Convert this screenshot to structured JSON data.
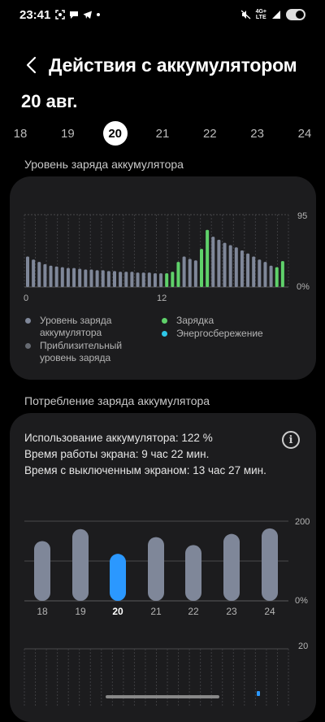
{
  "status": {
    "time": "23:41",
    "network_top": "4G+",
    "network_bottom": "LTE"
  },
  "header": {
    "title": "Действия с аккумулятором",
    "back_icon": "chevron-left-icon"
  },
  "date": "20 авг.",
  "days": [
    {
      "label": "18",
      "selected": false
    },
    {
      "label": "19",
      "selected": false
    },
    {
      "label": "20",
      "selected": true
    },
    {
      "label": "21",
      "selected": false
    },
    {
      "label": "22",
      "selected": false
    },
    {
      "label": "23",
      "selected": false
    },
    {
      "label": "24",
      "selected": false
    }
  ],
  "level_section": {
    "title": "Уровень заряда аккумулятора",
    "legend": {
      "level": "Уровень заряда аккумулятора",
      "charging": "Зарядка",
      "estimated": "Приблизительный уровень заряда",
      "power_saving": "Энергосбережение"
    }
  },
  "usage_section": {
    "title": "Потребление заряда аккумулятора",
    "usage": "Использование аккумулятора: 122 %",
    "screen_on": "Время работы экрана: 9 час 22 мин.",
    "screen_off": "Время с выключенным экраном: 13 час 27 мин."
  },
  "colors": {
    "level": "#7f8799",
    "charging": "#5fd16a",
    "estimated": "#666a72",
    "power_saving": "#2ec7e8",
    "selected_bar": "#2b98ff"
  },
  "chart_data": [
    {
      "type": "bar",
      "title": "Уровень заряда аккумулятора",
      "x_tick_labels": [
        "0",
        "12"
      ],
      "y_tick_labels": [
        "95",
        "0%"
      ],
      "ylim": [
        0,
        95
      ],
      "grid": true,
      "series": [
        {
          "name": "Уровень заряда аккумулятора",
          "values": [
            40,
            36,
            33,
            30,
            28,
            27,
            26,
            25,
            25,
            24,
            23,
            23,
            22,
            22,
            21,
            21,
            20,
            20,
            20,
            19,
            19,
            19,
            18,
            18,
            0,
            0,
            0,
            40,
            37,
            35,
            0,
            0,
            66,
            62,
            58,
            55,
            52,
            48,
            44,
            40,
            36,
            33,
            28,
            0
          ]
        },
        {
          "name": "Зарядка",
          "values": [
            0,
            0,
            0,
            0,
            0,
            0,
            0,
            0,
            0,
            0,
            0,
            0,
            0,
            0,
            0,
            0,
            0,
            0,
            0,
            0,
            0,
            0,
            0,
            0,
            18,
            20,
            33,
            0,
            0,
            0,
            50,
            75,
            0,
            0,
            0,
            0,
            0,
            0,
            0,
            0,
            0,
            0,
            0,
            26,
            34
          ]
        }
      ]
    },
    {
      "type": "bar",
      "title": "Потребление заряда аккумулятора",
      "categories": [
        "18",
        "19",
        "20",
        "21",
        "22",
        "23",
        "24"
      ],
      "values": [
        150,
        180,
        118,
        160,
        140,
        168,
        182
      ],
      "y_tick_labels": [
        "200",
        "0%"
      ],
      "ylim": [
        0,
        200
      ],
      "selected_category": "20",
      "grid": true
    },
    {
      "type": "bar",
      "title": "",
      "y_tick_labels": [
        "20"
      ],
      "ylim": [
        0,
        20
      ],
      "grid": true
    }
  ]
}
